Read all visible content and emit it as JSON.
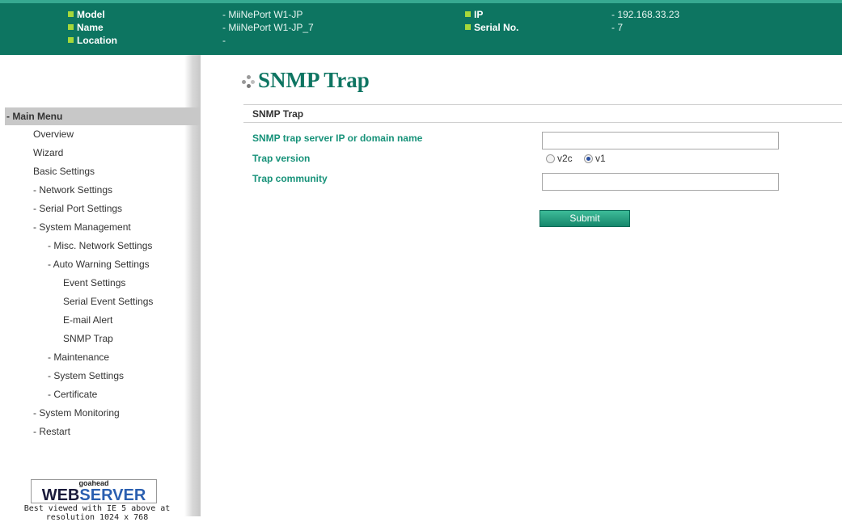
{
  "header": {
    "model_label": "Model",
    "name_label": "Name",
    "location_label": "Location",
    "model_value": "- MiiNePort W1-JP",
    "name_value": "- MiiNePort W1-JP_7",
    "location_value": "-",
    "ip_label": "IP",
    "serial_label": "Serial No.",
    "ip_value": "- 192.168.33.23",
    "serial_value": "- 7"
  },
  "menu": {
    "head": "- Main Menu",
    "items": [
      "Overview",
      "Wizard",
      "Basic Settings",
      "- Network Settings",
      "- Serial Port Settings",
      "- System Management",
      "- Misc. Network Settings",
      "- Auto Warning Settings",
      "Event Settings",
      "Serial Event Settings",
      "E-mail Alert",
      "SNMP Trap",
      "- Maintenance",
      "- System Settings",
      "- Certificate",
      "- System Monitoring",
      "- Restart"
    ]
  },
  "badge": {
    "goahead": "goahead",
    "web": "WEB",
    "server": "SERVER",
    "note_line1": "Best viewed with IE 5 above at",
    "note_line2": "resolution 1024 x 768"
  },
  "page": {
    "title": "SNMP Trap",
    "section": "SNMP Trap"
  },
  "form": {
    "server_label": "SNMP trap server IP or domain name",
    "server_value": "",
    "version_label": "Trap version",
    "version_options": [
      "v2c",
      "v1"
    ],
    "version_selected": "v1",
    "community_label": "Trap community",
    "community_value": "",
    "submit_label": "Submit"
  },
  "colors": {
    "header_bg": "#0d7561",
    "accent_text": "#179279",
    "title": "#0e7562",
    "bullet": "#a6d83a"
  }
}
